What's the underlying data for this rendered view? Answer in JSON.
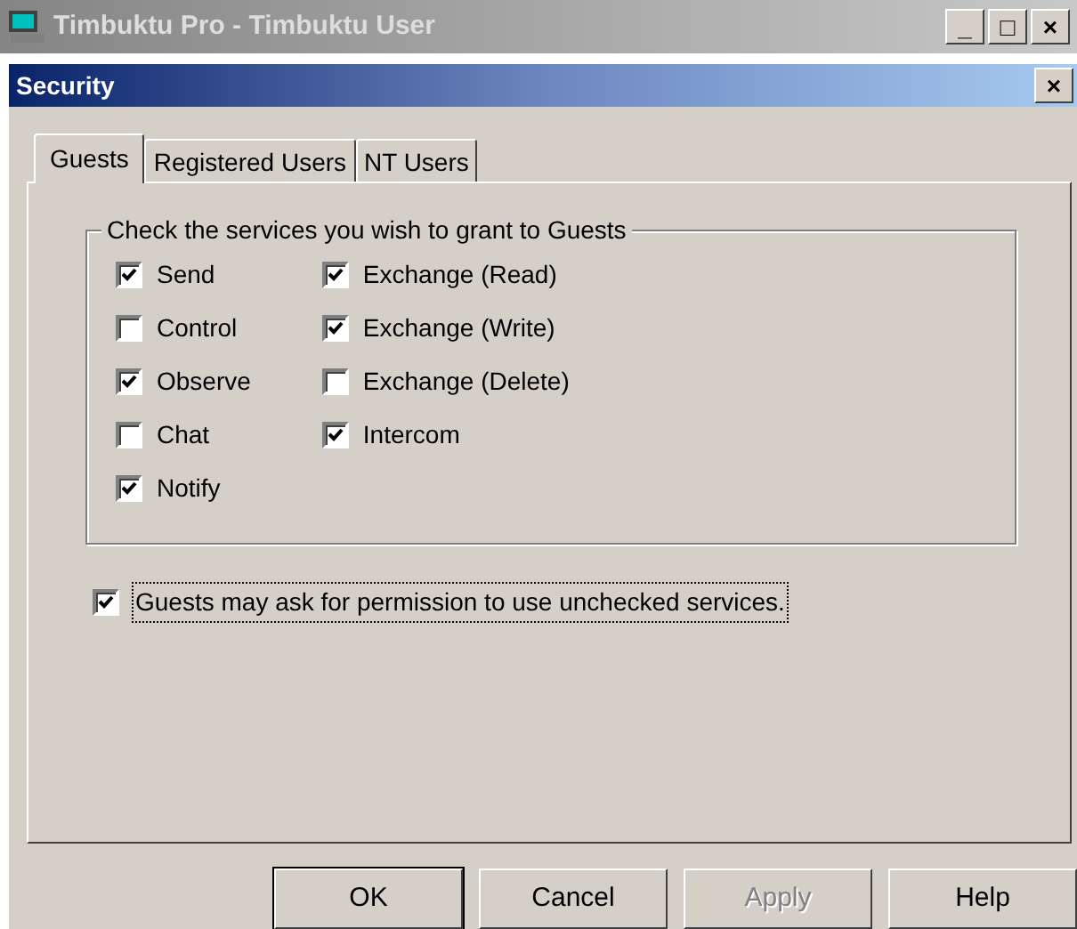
{
  "window": {
    "title": "Timbuktu Pro - Timbuktu User",
    "controls": [
      "_",
      "□",
      "×"
    ]
  },
  "dialog": {
    "title": "Security",
    "close": "×"
  },
  "tabs": [
    {
      "label": "Guests",
      "selected": true
    },
    {
      "label": "Registered Users",
      "selected": false
    },
    {
      "label": "NT Users",
      "selected": false
    }
  ],
  "group": {
    "title": "Check the services you wish to grant to Guests",
    "columns": [
      [
        {
          "label": "Send",
          "checked": true
        },
        {
          "label": "Control",
          "checked": false
        },
        {
          "label": "Observe",
          "checked": true
        },
        {
          "label": "Chat",
          "checked": false
        },
        {
          "label": "Notify",
          "checked": true
        }
      ],
      [
        {
          "label": "Exchange (Read)",
          "checked": true
        },
        {
          "label": "Exchange (Write)",
          "checked": true
        },
        {
          "label": "Exchange (Delete)",
          "checked": false
        },
        {
          "label": "Intercom",
          "checked": true
        }
      ]
    ]
  },
  "permission": {
    "label": "Guests may ask for permission to use unchecked services.",
    "checked": true,
    "focused": true
  },
  "buttons": [
    {
      "label": "OK",
      "default": true,
      "disabled": false
    },
    {
      "label": "Cancel",
      "default": false,
      "disabled": false
    },
    {
      "label": "Apply",
      "default": false,
      "disabled": true
    },
    {
      "label": "Help",
      "default": false,
      "disabled": false
    }
  ]
}
